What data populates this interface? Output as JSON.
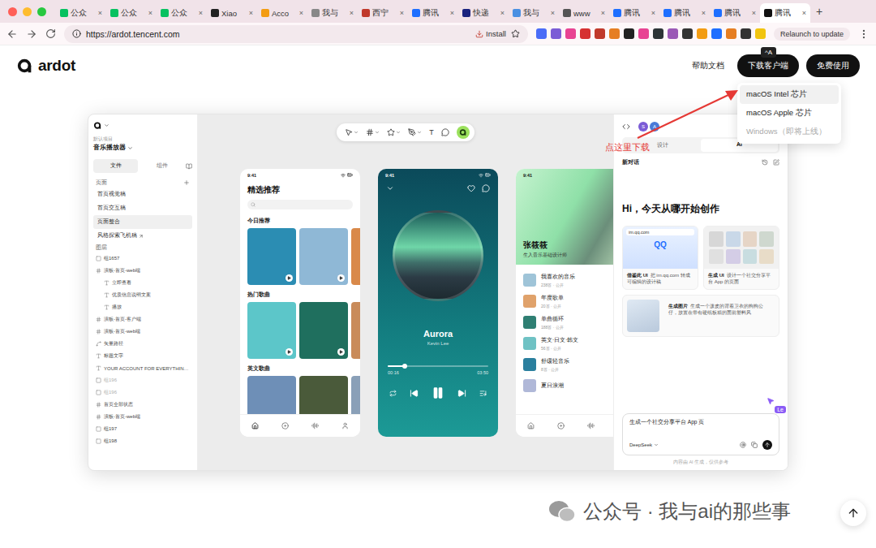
{
  "browser": {
    "tabs": [
      {
        "label": "公众",
        "selected": false,
        "color": "#07c160"
      },
      {
        "label": "公众",
        "selected": false,
        "color": "#07c160"
      },
      {
        "label": "公众",
        "selected": false,
        "color": "#07c160"
      },
      {
        "label": "Xiao",
        "selected": false,
        "color": "#222222"
      },
      {
        "label": "Acco",
        "selected": false,
        "color": "#f39c12"
      },
      {
        "label": "我与",
        "selected": false,
        "color": "#888888"
      },
      {
        "label": "西宁",
        "selected": false,
        "color": "#c0392b"
      },
      {
        "label": "腾讯",
        "selected": false,
        "color": "#1e6fff"
      },
      {
        "label": "快递",
        "selected": false,
        "color": "#1a237e"
      },
      {
        "label": "我与",
        "selected": false,
        "color": "#4a90e2"
      },
      {
        "label": "www",
        "selected": false,
        "color": "#555555"
      },
      {
        "label": "腾讯",
        "selected": false,
        "color": "#1e6fff"
      },
      {
        "label": "腾讯",
        "selected": false,
        "color": "#1e6fff"
      },
      {
        "label": "腾讯",
        "selected": false,
        "color": "#1e6fff"
      },
      {
        "label": "腾讯",
        "selected": true,
        "color": "#111111"
      }
    ],
    "close": "×",
    "new_tab": "+",
    "url": "https://ardot.tencent.com",
    "install": "Install",
    "extensions": [
      {
        "color": "#4a6cf7"
      },
      {
        "color": "#7b5cd6"
      },
      {
        "color": "#e84393"
      },
      {
        "color": "#d63031"
      },
      {
        "color": "#c0392b"
      },
      {
        "color": "#e67e22"
      },
      {
        "color": "#222222"
      },
      {
        "color": "#e84393"
      },
      {
        "color": "#2d3436"
      },
      {
        "color": "#9b59b6"
      },
      {
        "color": "#333333"
      },
      {
        "color": "#f39c12"
      },
      {
        "color": "#1e6fff"
      },
      {
        "color": "#e67e22"
      },
      {
        "color": "#333333"
      },
      {
        "color": "#f1c40f"
      }
    ],
    "relaunch": "Relaunch to update"
  },
  "header": {
    "logo": "ardot",
    "help": "帮助文档",
    "download": "下载客户端",
    "free": "免费使用",
    "tooltip": "^A"
  },
  "download_menu": [
    {
      "label": "macOS Intel 芯片",
      "selected": true,
      "disabled": false
    },
    {
      "label": "macOS Apple 芯片",
      "selected": false,
      "disabled": false
    },
    {
      "label": "Windows（即将上线）",
      "selected": false,
      "disabled": true
    }
  ],
  "annotation": "点这里下载",
  "app": {
    "left": {
      "project_label": "默认项目",
      "project": "音乐播放器",
      "tabs": [
        {
          "label": "文件",
          "selected": true
        },
        {
          "label": "组件",
          "selected": false
        }
      ],
      "pages_title": "页面",
      "pages": [
        {
          "label": "首页视觉稿",
          "selected": false
        },
        {
          "label": "首页交互稿",
          "selected": false
        },
        {
          "label": "页面整合",
          "selected": true
        },
        {
          "label": "风格探索飞机稿",
          "selected": false
        }
      ],
      "layers_title": "图层",
      "layers": [
        {
          "label": "组1657",
          "kind": "group",
          "depth": 0,
          "hidden": false
        },
        {
          "label": "演板-首页-web端",
          "kind": "frame",
          "depth": 0,
          "hidden": false
        },
        {
          "label": "立即查看",
          "kind": "text",
          "depth": 1,
          "hidden": false
        },
        {
          "label": "优质信息说明文案",
          "kind": "text",
          "depth": 1,
          "hidden": false
        },
        {
          "label": "播放",
          "kind": "text",
          "depth": 1,
          "hidden": false
        },
        {
          "label": "演板-首页-客户端",
          "kind": "frame",
          "depth": 0,
          "hidden": false
        },
        {
          "label": "演板-首页-web端",
          "kind": "frame",
          "depth": 0,
          "hidden": false
        },
        {
          "label": "矢量路径",
          "kind": "vector",
          "depth": 0,
          "hidden": false
        },
        {
          "label": "标题文字",
          "kind": "text",
          "depth": 0,
          "hidden": false
        },
        {
          "label": "YOUR ACCOUNT FOR EVERYTHIN…",
          "kind": "text",
          "depth": 0,
          "hidden": false
        },
        {
          "label": "组196",
          "kind": "group",
          "depth": 0,
          "hidden": true
        },
        {
          "label": "组196",
          "kind": "group",
          "depth": 0,
          "hidden": true
        },
        {
          "label": "首页全部状态",
          "kind": "frame",
          "depth": 0,
          "hidden": false
        },
        {
          "label": "演板-首页-web端",
          "kind": "frame",
          "depth": 0,
          "hidden": false
        },
        {
          "label": "组197",
          "kind": "group",
          "depth": 0,
          "hidden": false
        },
        {
          "label": "组198",
          "kind": "group",
          "depth": 0,
          "hidden": false
        }
      ]
    },
    "canvas": {
      "text_tool": "T",
      "playlist_phone": {
        "time": "9:41",
        "title": "精选推荐",
        "sections": [
          {
            "title": "今日推荐",
            "tiles": [
              {
                "color": "#2b8db3"
              },
              {
                "color": "#8fb8d6"
              },
              {
                "color": "#d9894a"
              }
            ]
          },
          {
            "title": "热门歌曲",
            "tiles": [
              {
                "color": "#5cc6c9"
              },
              {
                "color": "#1f6f5e"
              },
              {
                "color": "#c98b5a"
              }
            ]
          },
          {
            "title": "英文歌曲",
            "tiles": [
              {
                "color": "#6e8fb7"
              },
              {
                "color": "#4a5a3a"
              },
              {
                "color": "#8aa0b8"
              }
            ]
          }
        ]
      },
      "player_phone": {
        "time": "9:41",
        "song": "Aurora",
        "artist": "Kevin Lee",
        "elapsed": "00:16",
        "total": "03:50",
        "level": 0.17
      },
      "profile_phone": {
        "time": "9:41",
        "name": "张筱筱",
        "bio": "生入音乐基础设计师",
        "playlists": [
          {
            "title": "我喜欢的音乐",
            "sub": "238首 · 公开",
            "color": "#9fc4d8"
          },
          {
            "title": "年度歌单",
            "sub": "20首 · 公开",
            "color": "#e0a26b"
          },
          {
            "title": "单曲循环",
            "sub": "188首 · 公开",
            "color": "#2f7f73"
          },
          {
            "title": "英文·日文·韩文",
            "sub": "56首 · 公开",
            "color": "#6fc2c4"
          },
          {
            "title": "舒缓轻音乐",
            "sub": "8首 · 公开",
            "color": "#2a7f9e"
          },
          {
            "title": "夏日浪潮",
            "color": "#b0b8d8"
          }
        ]
      }
    },
    "right": {
      "avatars": [
        {
          "label": "S",
          "color": "#7b5cd6"
        },
        {
          "label": "A",
          "color": "#4a7bd8"
        }
      ],
      "tabs": [
        {
          "label": "设计",
          "selected": false
        },
        {
          "label": "AI",
          "selected": true
        }
      ],
      "new_chat": "新对话",
      "greeting": "Hi，今天从哪开始创作",
      "cards": [
        {
          "kind": "site",
          "url": "im.qq.com",
          "brand": "QQ",
          "title": "借鉴此 UI",
          "desc": "把 im.qq.com 转成可编辑的设计稿"
        },
        {
          "kind": "app",
          "title": "生成 UI",
          "desc": "设计一个社交分享平台 App 的页面"
        }
      ],
      "image_card": {
        "title": "生成图片",
        "desc": "生成一个泼皮的背着卫衣的狗狗公仔，放置在带有硬纸板箱的面前塑料风"
      },
      "input": "生成一个社交分享平台 App 页",
      "model": "DeepSeek",
      "disclaimer": "内容由 AI 生成，仅供参考",
      "cursor_label": "Le"
    }
  },
  "watermark": "公众号 · 我与ai的那些事"
}
